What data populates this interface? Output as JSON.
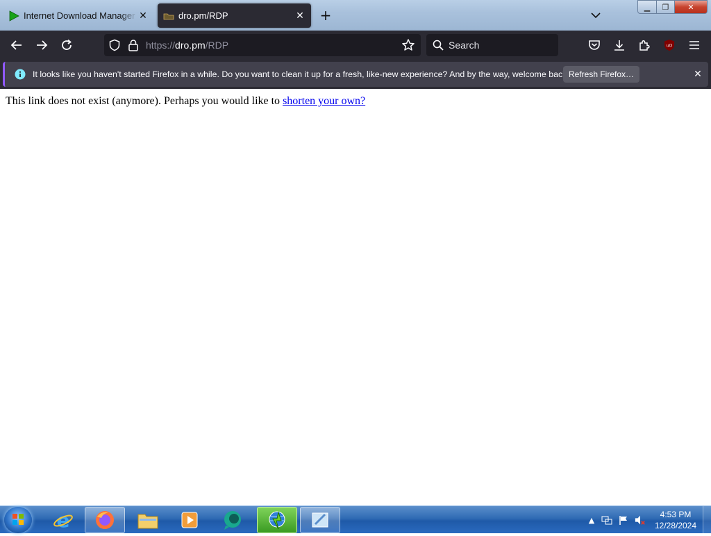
{
  "tabs": [
    {
      "title": "Internet Download Manager is",
      "favicon": "idm-play-icon",
      "active": false
    },
    {
      "title": "dro.pm/RDP",
      "favicon": "dro-pm-icon",
      "active": true
    }
  ],
  "navbar": {
    "url_prefix": "https://",
    "url_domain": "dro.pm",
    "url_path": "/RDP",
    "search_placeholder": "Search"
  },
  "notification": {
    "message": "It looks like you haven't started Firefox in a while. Do you want to clean it up for a fresh, like-new experience? And by the way, welcome back!",
    "button_label": "Refresh Firefox…"
  },
  "content": {
    "text": "This link does not exist (anymore). Perhaps you would like to ",
    "link_text": "shorten your own?"
  },
  "taskbar": {
    "apps": [
      "internet-explorer",
      "firefox",
      "windows-explorer",
      "media-player",
      "chat-app",
      "internet-download-manager",
      "notepad"
    ],
    "clock_time": "4:53 PM",
    "clock_date": "12/28/2024"
  },
  "colors": {
    "toolbar": "#2b2a33",
    "urlbar": "#1c1b22",
    "notification": "#42414d",
    "link": "#0000ee"
  }
}
